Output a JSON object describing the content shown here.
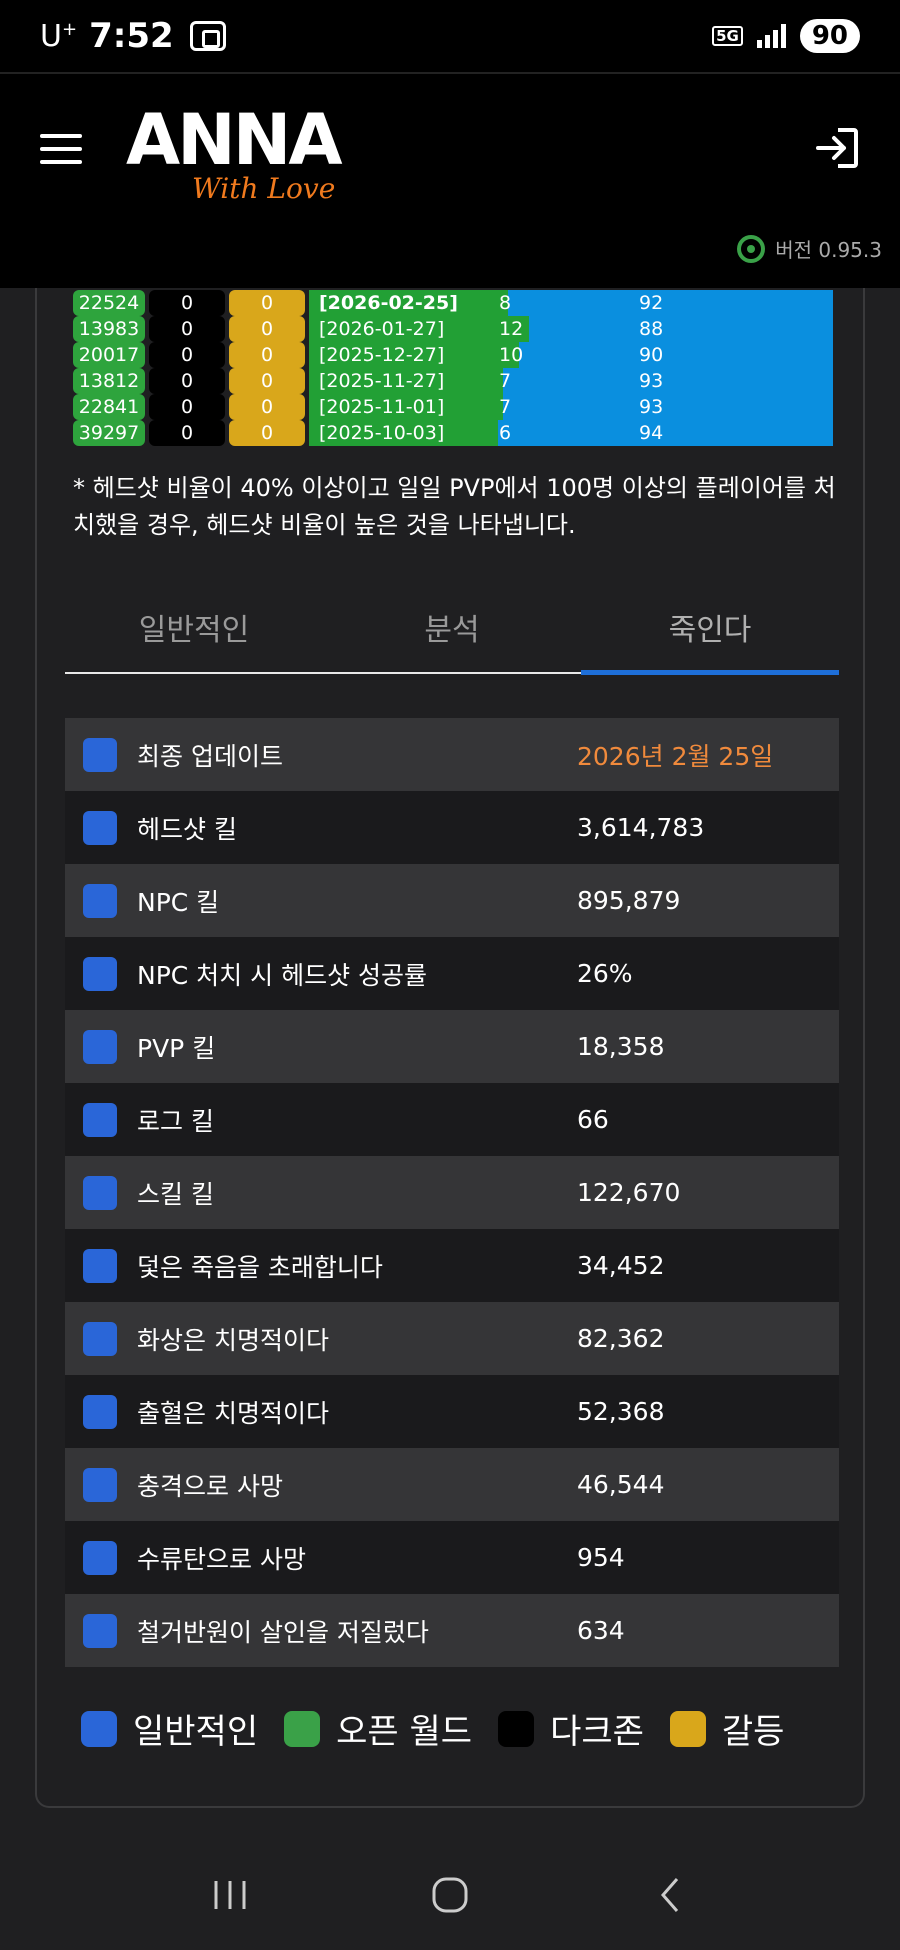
{
  "status_bar": {
    "carrier": "U",
    "carrier_sup": "+",
    "time": "7:52",
    "network": "5G",
    "battery": "90"
  },
  "header": {
    "logo_main": "ANNA",
    "logo_sub": "With Love",
    "version_label": "버전 0.95.3",
    "icons": {
      "menu": "hamburger-menu-icon",
      "login": "login-arrow-icon",
      "version": "broadcast-icon"
    }
  },
  "history": [
    {
      "count": "22524",
      "dark": "0",
      "conflict": "0",
      "date": "[2026-02-25]",
      "open_value": "8",
      "normal_value": "92",
      "open_pct": 8
    },
    {
      "count": "13983",
      "dark": "0",
      "conflict": "0",
      "date": "[2026-01-27]",
      "open_value": "12",
      "normal_value": "88",
      "open_pct": 12
    },
    {
      "count": "20017",
      "dark": "0",
      "conflict": "0",
      "date": "[2025-12-27]",
      "open_value": "10",
      "normal_value": "90",
      "open_pct": 10
    },
    {
      "count": "13812",
      "dark": "0",
      "conflict": "0",
      "date": "[2025-11-27]",
      "open_value": "7",
      "normal_value": "93",
      "open_pct": 7
    },
    {
      "count": "22841",
      "dark": "0",
      "conflict": "0",
      "date": "[2025-11-01]",
      "open_value": "7",
      "normal_value": "93",
      "open_pct": 7
    },
    {
      "count": "39297",
      "dark": "0",
      "conflict": "0",
      "date": "[2025-10-03]",
      "open_value": "6",
      "normal_value": "94",
      "open_pct": 6
    }
  ],
  "note": "* 헤드샷 비율이 40% 이상이고 일일 PVP에서 100명 이상의 플레이어를 처치했을 경우, 헤드샷 비율이 높은 것을 나타냅니다.",
  "tabs": [
    {
      "label": "일반적인",
      "active": false
    },
    {
      "label": "분석",
      "active": false
    },
    {
      "label": "죽인다",
      "active": true
    }
  ],
  "stats": [
    {
      "label": "최종 업데이트",
      "value": "2026년 2월 25일",
      "accent": true
    },
    {
      "label": "헤드샷 킬",
      "value": "3,614,783"
    },
    {
      "label": "NPC 킬",
      "value": "895,879"
    },
    {
      "label": "NPC 처치 시 헤드샷 성공률",
      "value": "26%"
    },
    {
      "label": "PVP 킬",
      "value": "18,358"
    },
    {
      "label": "로그 킬",
      "value": "66"
    },
    {
      "label": "스킬 킬",
      "value": "122,670"
    },
    {
      "label": "덫은 죽음을 초래합니다",
      "value": "34,452"
    },
    {
      "label": "화상은 치명적이다",
      "value": "82,362"
    },
    {
      "label": "출혈은 치명적이다",
      "value": "52,368"
    },
    {
      "label": "충격으로 사망",
      "value": "46,544"
    },
    {
      "label": "수류탄으로 사망",
      "value": "954"
    },
    {
      "label": "철거반원이 살인을 저질렀다",
      "value": "634"
    }
  ],
  "legend": [
    {
      "label": "일반적인",
      "color": "#2a66d8"
    },
    {
      "label": "오픈 월드",
      "color": "#3aa148"
    },
    {
      "label": "다크존",
      "color": "#000000"
    },
    {
      "label": "갈등",
      "color": "#d9a71b"
    }
  ],
  "colors": {
    "accent": "#f08a3c",
    "tab_active": "#1e6fd9",
    "brand_orange": "#f07a1e"
  },
  "nav": {
    "icons": [
      "recent-apps-icon",
      "home-icon",
      "back-icon"
    ]
  }
}
